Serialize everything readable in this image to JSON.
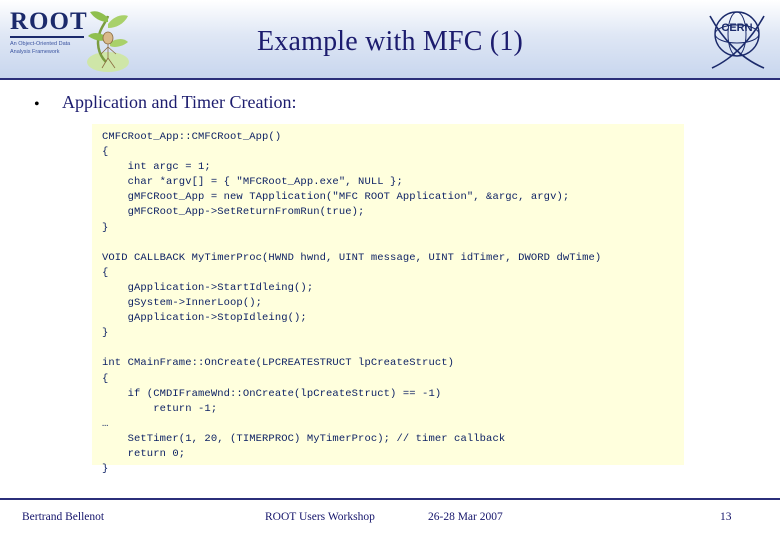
{
  "header": {
    "title": "Example with MFC (1)",
    "root_logo": {
      "word": "ROOT",
      "subtitle": "An Object-Oriented Data Analysis Framework",
      "icon": "root-figure-icon"
    },
    "cern_logo": {
      "label": "CERN",
      "icon": "cern-logo-icon"
    }
  },
  "body": {
    "bullet": {
      "marker": "•",
      "text": "Application and Timer Creation:"
    },
    "code": "CMFCRoot_App::CMFCRoot_App()\n{\n    int argc = 1;\n    char *argv[] = { \"MFCRoot_App.exe\", NULL };\n    gMFCRoot_App = new TApplication(\"MFC ROOT Application\", &argc, argv);\n    gMFCRoot_App->SetReturnFromRun(true);\n}\n\nVOID CALLBACK MyTimerProc(HWND hwnd, UINT message, UINT idTimer, DWORD dwTime)\n{\n    gApplication->StartIdleing();\n    gSystem->InnerLoop();\n    gApplication->StopIdleing();\n}\n\nint CMainFrame::OnCreate(LPCREATESTRUCT lpCreateStruct)\n{\n    if (CMDIFrameWnd::OnCreate(lpCreateStruct) == -1)\n        return -1;\n…\n    SetTimer(1, 20, (TIMERPROC) MyTimerProc); // timer callback\n    return 0;\n}"
  },
  "footer": {
    "author": "Bertrand Bellenot",
    "event": "ROOT Users Workshop",
    "date": "26-28 Mar 2007",
    "page": "13"
  },
  "colors": {
    "title": "#1c1c6e",
    "rule": "#2b2f7a",
    "code_bg": "#ffffdd",
    "code_text": "#0b1f63",
    "header_gradient_end": "#c8d6ee"
  }
}
